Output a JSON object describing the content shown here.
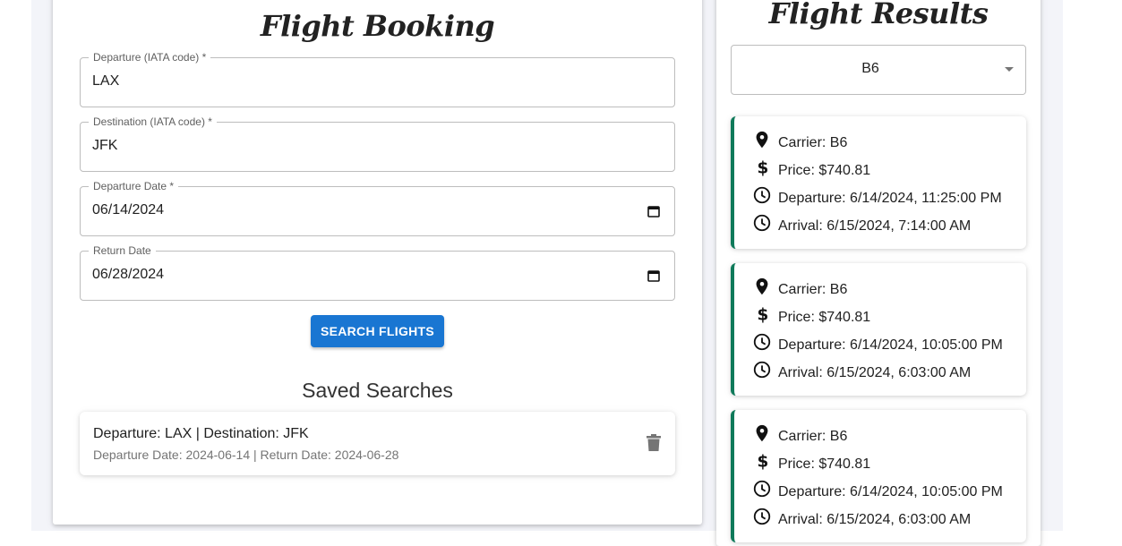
{
  "booking": {
    "title": "Flight Booking",
    "fields": [
      {
        "label": "Departure (IATA code) *",
        "value": "LAX"
      },
      {
        "label": "Destination (IATA code) *",
        "value": "JFK"
      },
      {
        "label": "Departure Date *",
        "value": "06/14/2024"
      },
      {
        "label": "Return Date",
        "value": "06/28/2024"
      }
    ],
    "search_button": "SEARCH FLIGHTS",
    "saved_heading": "Saved Searches",
    "saved_items": [
      {
        "primary": "Departure: LAX | Destination: JFK",
        "secondary": "Departure Date: 2024-06-14 | Return Date: 2024-06-28"
      }
    ]
  },
  "results": {
    "title": "Flight Results",
    "filter_value": "B6",
    "flights": [
      {
        "carrier": "Carrier: B6",
        "price": "Price: $740.81",
        "departure": "Departure: 6/14/2024, 11:25:00 PM",
        "arrival": "Arrival: 6/15/2024, 7:14:00 AM"
      },
      {
        "carrier": "Carrier: B6",
        "price": "Price: $740.81",
        "departure": "Departure: 6/14/2024, 10:05:00 PM",
        "arrival": "Arrival: 6/15/2024, 6:03:00 AM"
      },
      {
        "carrier": "Carrier: B6",
        "price": "Price: $740.81",
        "departure": "Departure: 6/14/2024, 10:05:00 PM",
        "arrival": "Arrival: 6/15/2024, 6:03:00 AM"
      }
    ]
  },
  "colors": {
    "primary_button": "#1976d2",
    "flight_accent": "#0f7a5a",
    "page_background": "#f3f4f9"
  },
  "icons": {
    "carrier": "location-pin-icon",
    "price": "dollar-icon",
    "departure": "clock-icon",
    "arrival": "clock-icon",
    "date_picker": "calendar-icon",
    "delete": "trash-icon",
    "select": "dropdown-arrow-icon"
  }
}
